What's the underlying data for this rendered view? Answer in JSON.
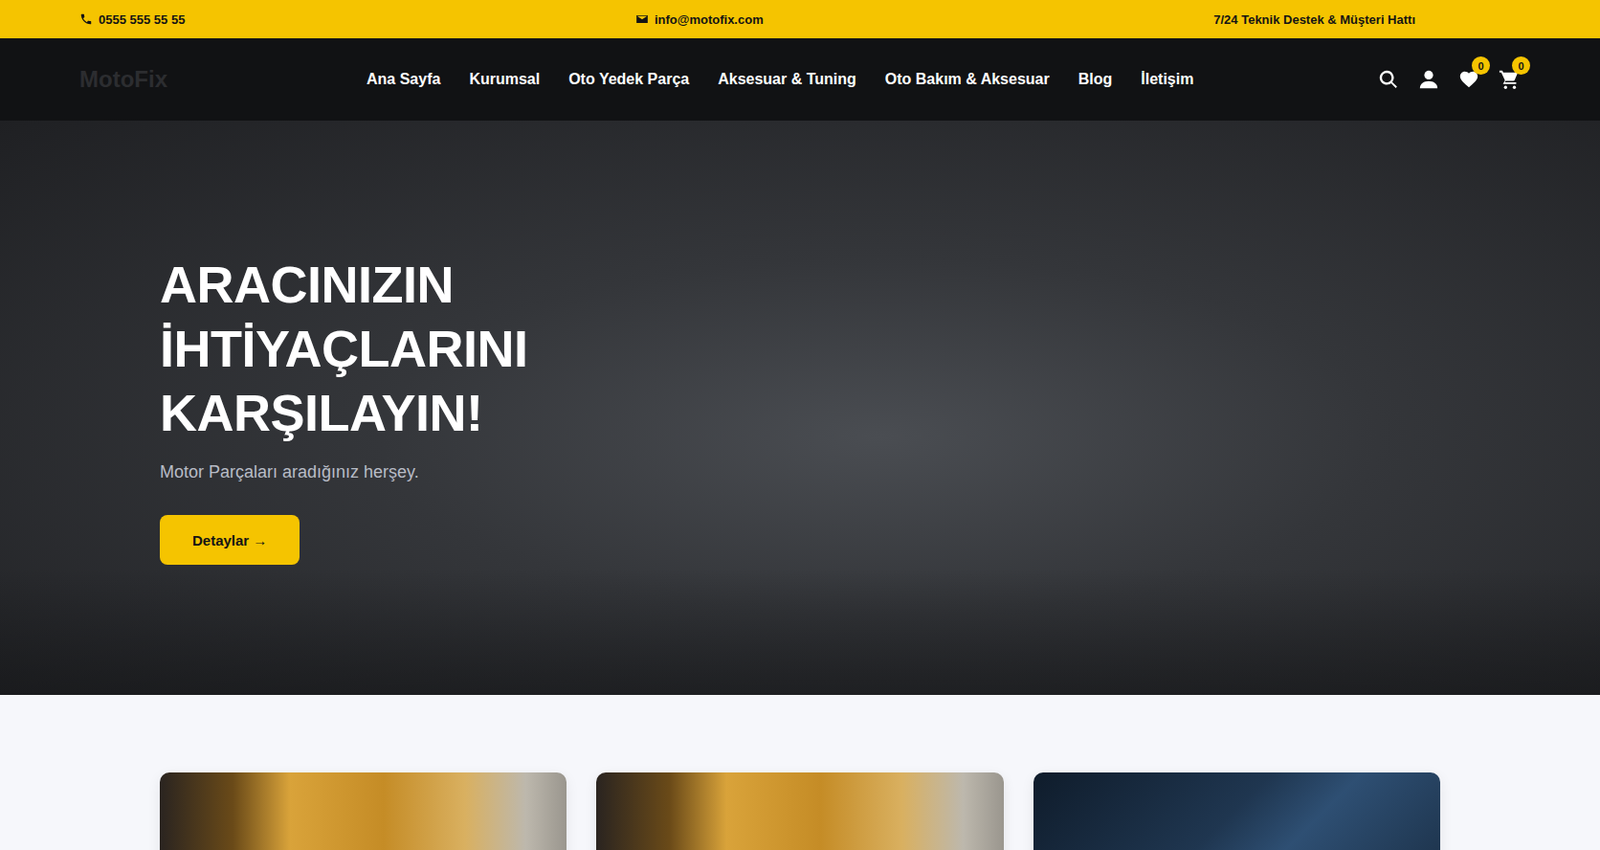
{
  "topbar": {
    "phone": "0555 555 55 55",
    "email": "info@motofix.com",
    "support": "7/24 Teknik Destek & Müşteri Hattı"
  },
  "nav": {
    "logo": "MotoFix",
    "items": [
      "Ana Sayfa",
      "Kurumsal",
      "Oto Yedek Parça",
      "Aksesuar & Tuning",
      "Oto Bakım & Aksesuar",
      "Blog",
      "İletişim"
    ]
  },
  "header_icons": {
    "wishlist_count": "0",
    "cart_count": "0"
  },
  "hero": {
    "title_lines": [
      "ARACINIZIN",
      "İHTİYAÇLARINI",
      "KARŞILAYIN!"
    ],
    "subtitle": "Motor Parçaları aradığınız herşey.",
    "button": {
      "label": "Detaylar",
      "arrow": "→"
    }
  }
}
